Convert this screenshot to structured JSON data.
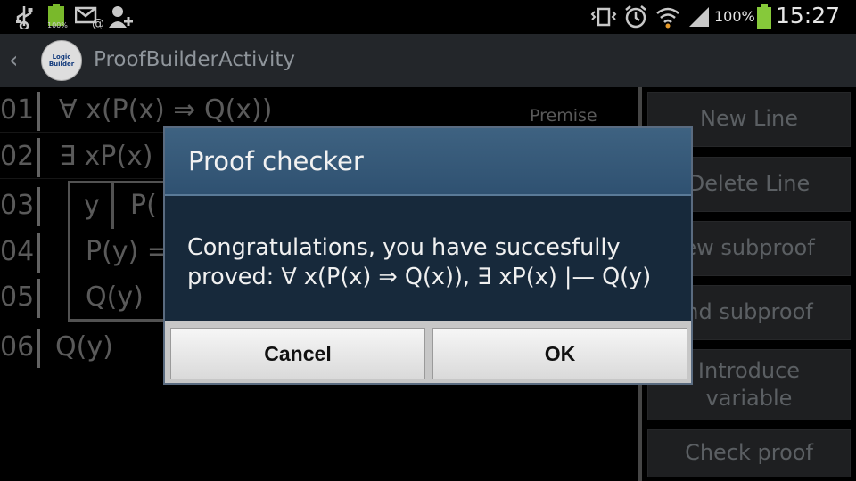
{
  "status_bar": {
    "left_icons": [
      "usb-icon",
      "battery-full-icon",
      "email-notification-icon",
      "add-contact-icon"
    ],
    "battery_icon_label": "100%",
    "right_icons": [
      "vibrate-icon",
      "alarm-icon",
      "wifi-icon",
      "signal-icon",
      "battery-icon"
    ],
    "battery_percent": "100%",
    "time": "15:27"
  },
  "action_bar": {
    "logo_text": "Logic Builder",
    "title": "ProofBuilderActivity"
  },
  "proof": {
    "lines": [
      {
        "num": "01",
        "formula": "∀ x(P(x) ⇒ Q(x))",
        "justification": "Premise"
      },
      {
        "num": "02",
        "formula": "∃ xP(x)"
      },
      {
        "num": "03",
        "var": "y",
        "formula": "P("
      },
      {
        "num": "04",
        "formula": "P(y) ="
      },
      {
        "num": "05",
        "formula": "Q(y)"
      },
      {
        "num": "06",
        "formula": "Q(y)"
      }
    ]
  },
  "side_buttons": [
    "New Line",
    "Delete Line",
    "ew subproof",
    "nd subproof",
    "Introduce variable",
    "Check proof"
  ],
  "dialog": {
    "title": "Proof checker",
    "message_line1": "Congratulations, you have succesfully",
    "message_line2": "proved:  ∀ x(P(x) ⇒ Q(x)),  ∃ xP(x)  |—  Q(y)",
    "cancel_label": "Cancel",
    "ok_label": "OK"
  }
}
